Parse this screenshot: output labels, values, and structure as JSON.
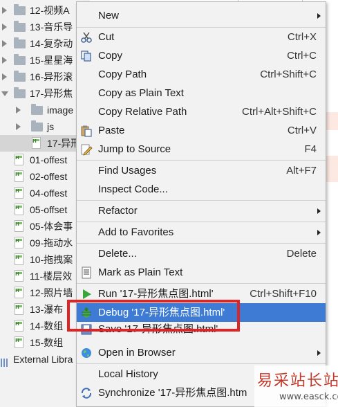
{
  "tree": {
    "items": [
      {
        "label": "12-视频A",
        "kind": "folder",
        "expanded": false
      },
      {
        "label": "13-音乐导",
        "kind": "folder",
        "expanded": false
      },
      {
        "label": "14-复杂动",
        "kind": "folder",
        "expanded": false
      },
      {
        "label": "15-星星海",
        "kind": "folder",
        "expanded": false
      },
      {
        "label": "16-异形滚",
        "kind": "folder",
        "expanded": false
      },
      {
        "label": "17-异形焦",
        "kind": "folder",
        "expanded": true
      },
      {
        "label": "image",
        "kind": "subfolder",
        "expanded": false
      },
      {
        "label": "js",
        "kind": "subfolder",
        "expanded": false
      },
      {
        "label": "17-异形",
        "kind": "subfile",
        "selected": true
      },
      {
        "label": "01-offest",
        "kind": "file"
      },
      {
        "label": "02-offest",
        "kind": "file"
      },
      {
        "label": "04-offest",
        "kind": "file"
      },
      {
        "label": "05-offset",
        "kind": "file"
      },
      {
        "label": "05-体会事",
        "kind": "file"
      },
      {
        "label": "09-拖动水",
        "kind": "file"
      },
      {
        "label": "10-拖拽案",
        "kind": "file"
      },
      {
        "label": "11-楼层效",
        "kind": "file"
      },
      {
        "label": "12-照片墙",
        "kind": "file"
      },
      {
        "label": "13-瀑布",
        "kind": "file"
      },
      {
        "label": "14-数组",
        "kind": "file"
      },
      {
        "label": "15-数组",
        "kind": "file"
      }
    ],
    "external_libraries": "External Libra"
  },
  "menu": {
    "new": {
      "label": "New"
    },
    "cut": {
      "label": "Cut",
      "shortcut": "Ctrl+X"
    },
    "copy": {
      "label": "Copy",
      "shortcut": "Ctrl+C"
    },
    "copy_path": {
      "label": "Copy Path",
      "shortcut": "Ctrl+Shift+C"
    },
    "copy_plain": {
      "label": "Copy as Plain Text"
    },
    "copy_relative": {
      "label": "Copy Relative Path",
      "shortcut": "Ctrl+Alt+Shift+C"
    },
    "paste": {
      "label": "Paste",
      "shortcut": "Ctrl+V"
    },
    "jump_source": {
      "label": "Jump to Source",
      "shortcut": "F4"
    },
    "find_usages": {
      "label": "Find Usages",
      "shortcut": "Alt+F7"
    },
    "inspect_code": {
      "label": "Inspect Code..."
    },
    "refactor": {
      "label": "Refactor"
    },
    "add_favorites": {
      "label": "Add to Favorites"
    },
    "delete": {
      "label": "Delete...",
      "shortcut": "Delete"
    },
    "mark_plain": {
      "label": "Mark as Plain Text"
    },
    "run": {
      "label": "Run '17-异形焦点图.html'",
      "shortcut": "Ctrl+Shift+F10"
    },
    "debug": {
      "label": "Debug '17-异形焦点图.html'"
    },
    "save": {
      "label": "Save '17-异形焦点图.html'"
    },
    "open_browser": {
      "label": "Open in Browser"
    },
    "local_history": {
      "label": "Local History"
    },
    "synchronize": {
      "label": "Synchronize '17-异形焦点图.htm"
    }
  },
  "watermark": {
    "line1": "易采站长站",
    "line2": "www.easck.com"
  },
  "colors": {
    "highlight": "#3d7bd4",
    "annotation_box": "#e02424",
    "run_icon": "#3aa53a"
  }
}
